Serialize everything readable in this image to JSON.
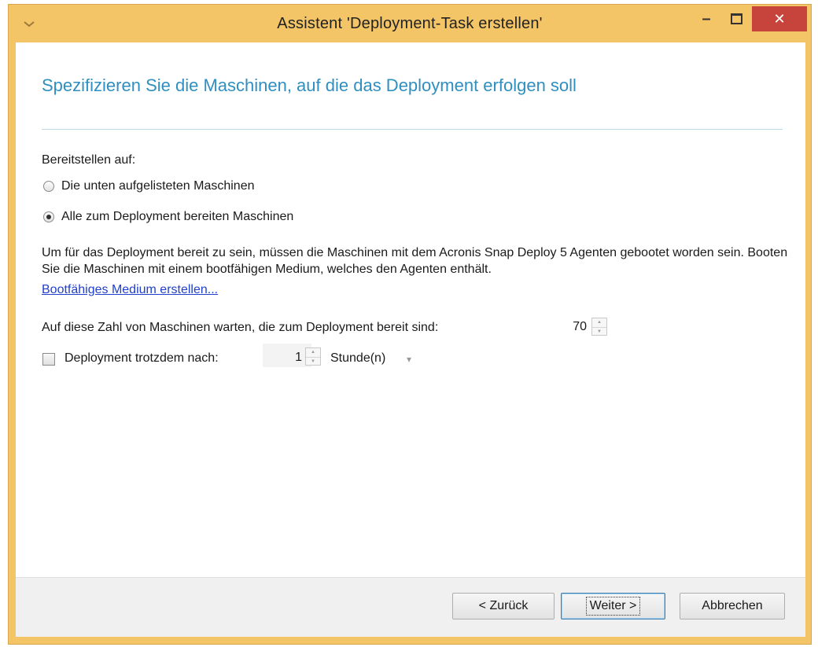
{
  "window": {
    "title": "Assistent 'Deployment-Task erstellen'",
    "sysmenu_icon": "chevron-down-icon",
    "minimize_icon": "minimize-icon",
    "maximize_icon": "maximize-icon",
    "close_icon": "close-icon",
    "minimize_glyph": "–",
    "close_glyph": "✕"
  },
  "page": {
    "heading": "Spezifizieren Sie die Maschinen, auf die das Deployment erfolgen soll",
    "deploy_label": "Bereitstellen auf:",
    "radio_options": [
      {
        "label": "Die unten aufgelisteten Maschinen",
        "selected": false
      },
      {
        "label": "Alle zum Deployment bereiten Maschinen",
        "selected": true
      }
    ],
    "info_text": "Um für das Deployment bereit zu sein, müssen die Maschinen mit dem Acronis Snap Deploy 5 Agenten gebootet worden sein. Booten Sie die Maschinen mit einem bootfähigen Medium, welches den Agenten enthält.",
    "link_text": "Bootfähiges Medium erstellen...",
    "wait_label": "Auf diese Zahl von Maschinen warten, die zum Deployment bereit sind:",
    "wait_count": "70",
    "deploy_anyway_label": "Deployment trotzdem nach:",
    "deploy_anyway_checked": false,
    "deploy_anyway_value": "1",
    "unit_selected": "Stunde(n)"
  },
  "footer": {
    "back_label": "< Zurück",
    "next_label": "Weiter >",
    "cancel_label": "Abbrechen"
  },
  "colors": {
    "frame": "#f4c567",
    "heading": "#2f8fc0",
    "close_button": "#c7443c",
    "link": "#1f3fcc"
  }
}
